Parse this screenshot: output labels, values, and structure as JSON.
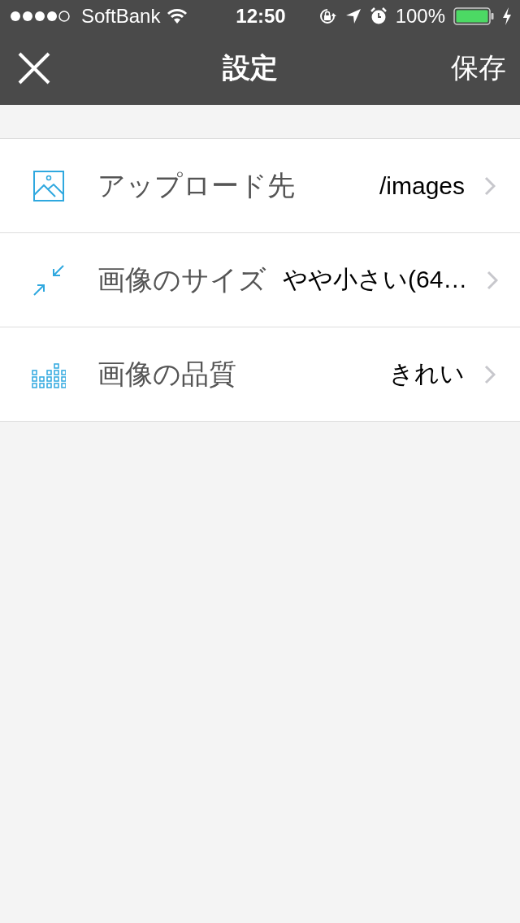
{
  "status_bar": {
    "carrier": "SoftBank",
    "time": "12:50",
    "battery": "100%"
  },
  "nav_bar": {
    "title": "設定",
    "action": "保存"
  },
  "settings": [
    {
      "kind": "image",
      "label": "アップロード先",
      "value": "/images"
    },
    {
      "kind": "resize",
      "label": "画像のサイズ",
      "value": "やや小さい(64…"
    },
    {
      "kind": "quality",
      "label": "画像の品質",
      "value": "きれい"
    }
  ]
}
